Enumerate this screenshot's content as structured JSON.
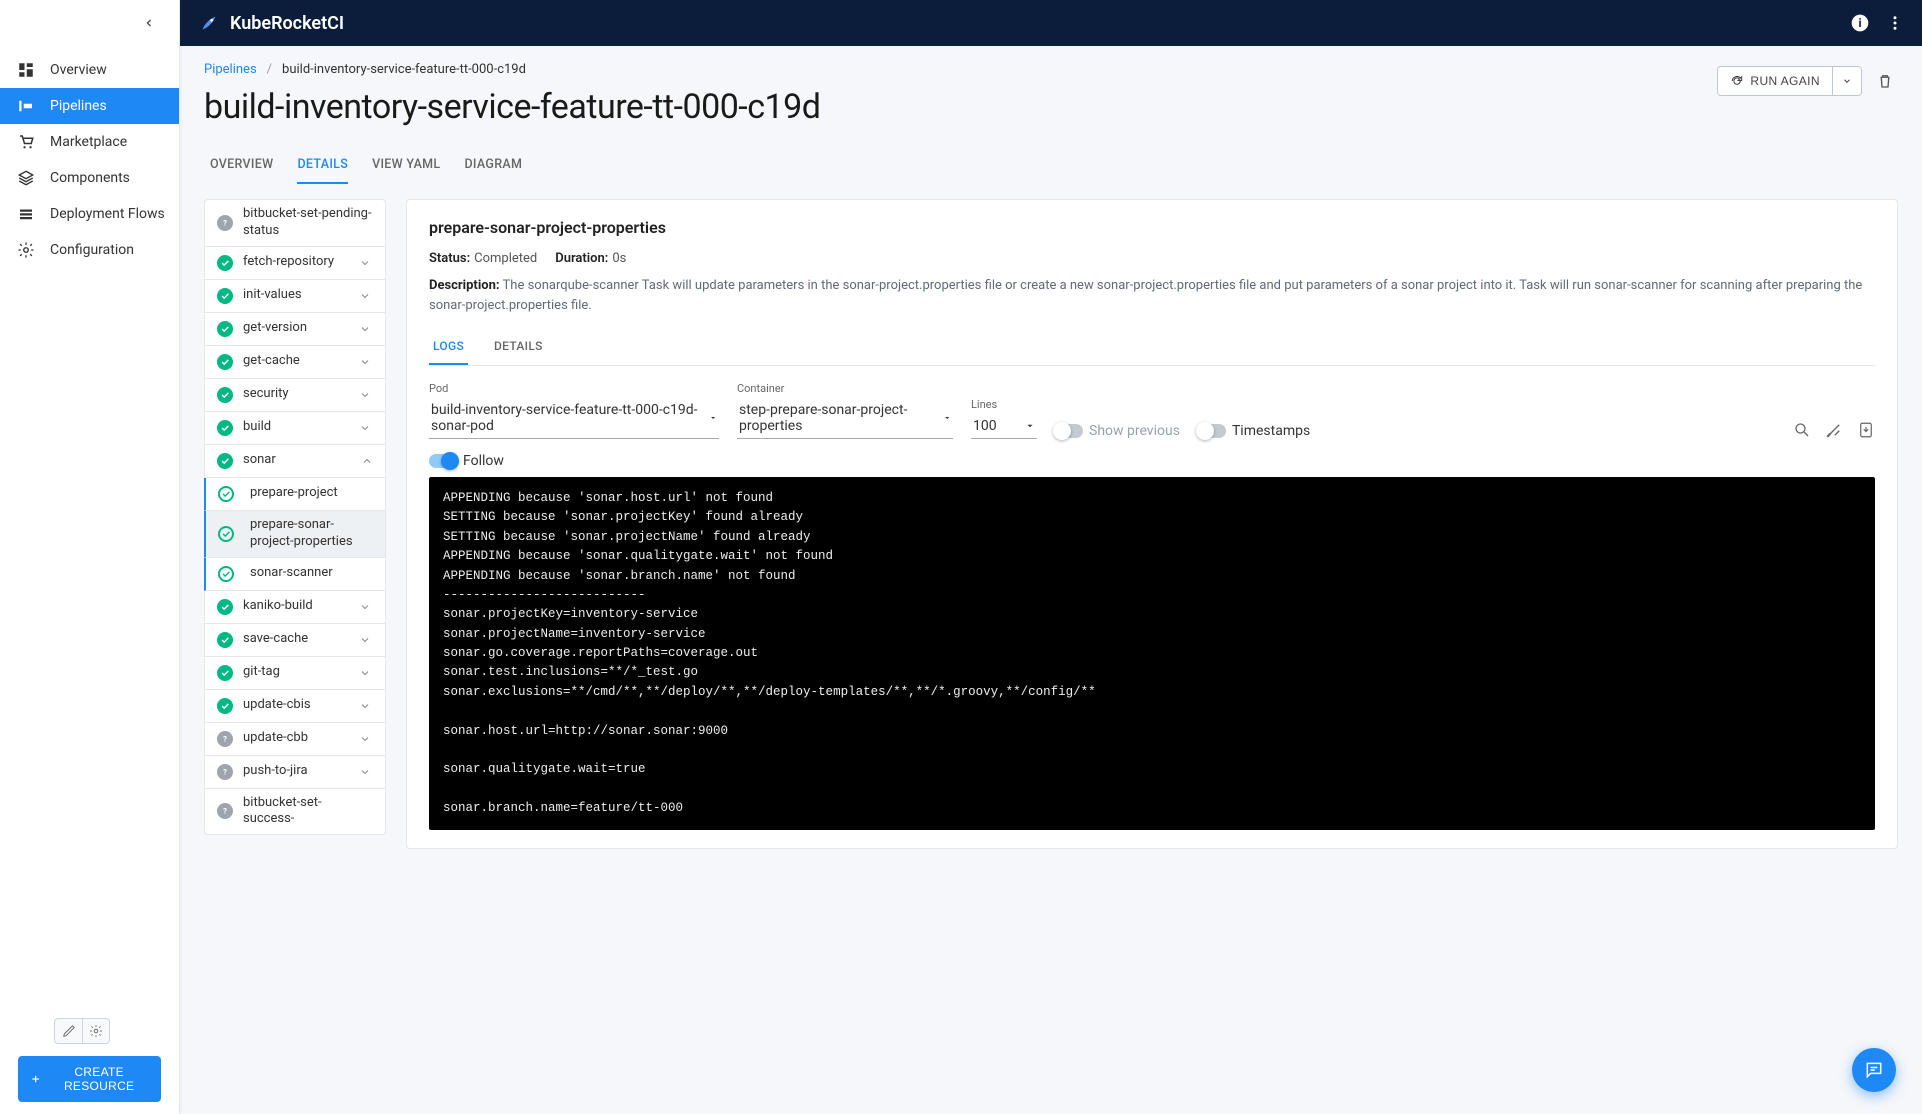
{
  "brand": "KubeRocketCI",
  "sidebar": {
    "items": [
      {
        "label": "Overview",
        "icon": "dashboard"
      },
      {
        "label": "Pipelines",
        "icon": "pipeline",
        "active": true
      },
      {
        "label": "Marketplace",
        "icon": "cart"
      },
      {
        "label": "Components",
        "icon": "layers"
      },
      {
        "label": "Deployment Flows",
        "icon": "flows"
      },
      {
        "label": "Configuration",
        "icon": "gear"
      }
    ],
    "create_label": "CREATE RESOURCE"
  },
  "breadcrumb": {
    "root": "Pipelines",
    "current": "build-inventory-service-feature-tt-000-c19d"
  },
  "page_title": "build-inventory-service-feature-tt-000-c19d",
  "run_again": "RUN AGAIN",
  "tabs": [
    {
      "label": "OVERVIEW"
    },
    {
      "label": "DETAILS",
      "active": true
    },
    {
      "label": "VIEW YAML"
    },
    {
      "label": "DIAGRAM"
    }
  ],
  "tasks": [
    {
      "label": "bitbucket-set-pending-status",
      "status": "pending"
    },
    {
      "label": "fetch-repository",
      "status": "success",
      "expandable": true
    },
    {
      "label": "init-values",
      "status": "success",
      "expandable": true
    },
    {
      "label": "get-version",
      "status": "success",
      "expandable": true
    },
    {
      "label": "get-cache",
      "status": "success",
      "expandable": true
    },
    {
      "label": "security",
      "status": "success",
      "expandable": true
    },
    {
      "label": "build",
      "status": "success",
      "expandable": true
    },
    {
      "label": "sonar",
      "status": "success",
      "expandable": true,
      "expanded": true,
      "children": [
        {
          "label": "prepare-project",
          "status": "sub"
        },
        {
          "label": "prepare-sonar-project-properties",
          "status": "sub",
          "selected": true
        },
        {
          "label": "sonar-scanner",
          "status": "sub"
        }
      ]
    },
    {
      "label": "kaniko-build",
      "status": "success",
      "expandable": true
    },
    {
      "label": "save-cache",
      "status": "success",
      "expandable": true
    },
    {
      "label": "git-tag",
      "status": "success",
      "expandable": true
    },
    {
      "label": "update-cbis",
      "status": "success",
      "expandable": true
    },
    {
      "label": "update-cbb",
      "status": "pending",
      "expandable": true
    },
    {
      "label": "push-to-jira",
      "status": "pending",
      "expandable": true
    },
    {
      "label": "bitbucket-set-success-",
      "status": "pending"
    }
  ],
  "step": {
    "title": "prepare-sonar-project-properties",
    "status_label": "Status:",
    "status_value": "Completed",
    "duration_label": "Duration:",
    "duration_value": "0s",
    "desc_label": "Description:",
    "desc_value": "The sonarqube-scanner Task will update parameters in the sonar-project.properties file or create a new sonar-project.properties file and put parameters of a sonar project into it. Task will run sonar-scanner for scanning after preparing the sonar-project.properties file."
  },
  "subtabs": [
    {
      "label": "LOGS",
      "active": true
    },
    {
      "label": "DETAILS"
    }
  ],
  "log_selects": {
    "pod": {
      "label": "Pod",
      "value": "build-inventory-service-feature-tt-000-c19d-sonar-pod"
    },
    "container": {
      "label": "Container",
      "value": "step-prepare-sonar-project-properties"
    },
    "lines": {
      "label": "Lines",
      "value": "100"
    }
  },
  "toggles": {
    "show_previous": "Show previous",
    "timestamps": "Timestamps",
    "follow": "Follow"
  },
  "console": "APPENDING because 'sonar.host.url' not found\nSETTING because 'sonar.projectKey' found already\nSETTING because 'sonar.projectName' found already\nAPPENDING because 'sonar.qualitygate.wait' not found\nAPPENDING because 'sonar.branch.name' not found\n---------------------------\nsonar.projectKey=inventory-service\nsonar.projectName=inventory-service\nsonar.go.coverage.reportPaths=coverage.out\nsonar.test.inclusions=**/*_test.go\nsonar.exclusions=**/cmd/**,**/deploy/**,**/deploy-templates/**,**/*.groovy,**/config/**\n\nsonar.host.url=http://sonar.sonar:9000\n\nsonar.qualitygate.wait=true\n\nsonar.branch.name=feature/tt-000"
}
